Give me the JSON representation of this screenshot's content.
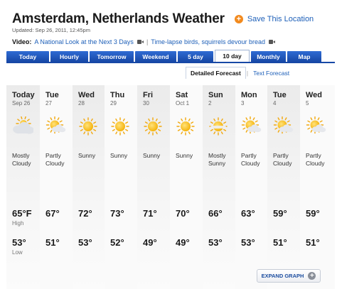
{
  "header": {
    "title": "Amsterdam, Netherlands Weather",
    "save_label": "This Location",
    "save_prefix": "Save",
    "save_icon": "plus-circle-icon",
    "updated": "Updated: Sep 26, 2011, 12:45pm"
  },
  "video": {
    "label": "Video:",
    "link1": "A National Look at the Next 3 Days",
    "separator": "|",
    "link2": "Time-lapse birds, squirrels devour bread"
  },
  "tabs": [
    {
      "label": "Today"
    },
    {
      "label": "Hourly"
    },
    {
      "label": "Tomorrow"
    },
    {
      "label": "Weekend"
    },
    {
      "label": "5 day"
    },
    {
      "label": "10 day",
      "active": true
    },
    {
      "label": "Monthly"
    },
    {
      "label": "Map"
    }
  ],
  "subtabs": {
    "detailed": "Detailed Forecast",
    "separator": "|",
    "text": "Text Forecast"
  },
  "forecast": [
    {
      "day": "Today",
      "date": "Sep 26",
      "icon": "mostly-cloudy-icon",
      "condition": "Mostly Cloudy",
      "high": "65°F",
      "high_label": "High",
      "low": "53°",
      "low_label": "Low"
    },
    {
      "day": "Tue",
      "date": "27",
      "icon": "partly-cloudy-icon",
      "condition": "Partly Cloudy",
      "high": "67°",
      "low": "51°"
    },
    {
      "day": "Wed",
      "date": "28",
      "icon": "sunny-icon",
      "condition": "Sunny",
      "high": "72°",
      "low": "53°"
    },
    {
      "day": "Thu",
      "date": "29",
      "icon": "sunny-icon",
      "condition": "Sunny",
      "high": "73°",
      "low": "52°"
    },
    {
      "day": "Fri",
      "date": "30",
      "icon": "sunny-icon",
      "condition": "Sunny",
      "high": "71°",
      "low": "49°"
    },
    {
      "day": "Sat",
      "date": "Oct 1",
      "icon": "sunny-icon",
      "condition": "Sunny",
      "high": "70°",
      "low": "49°"
    },
    {
      "day": "Sun",
      "date": "2",
      "icon": "mostly-sunny-icon",
      "condition": "Mostly Sunny",
      "high": "66°",
      "low": "53°"
    },
    {
      "day": "Mon",
      "date": "3",
      "icon": "partly-cloudy-icon",
      "condition": "Partly Cloudy",
      "high": "63°",
      "low": "53°"
    },
    {
      "day": "Tue",
      "date": "4",
      "icon": "partly-cloudy-icon",
      "condition": "Partly Cloudy",
      "high": "59°",
      "low": "51°"
    },
    {
      "day": "Wed",
      "date": "5",
      "icon": "partly-cloudy-icon",
      "condition": "Partly Cloudy",
      "high": "59°",
      "low": "51°"
    }
  ],
  "expand_graph": {
    "label": "EXPAND GRAPH",
    "icon": "plus-circle-icon"
  },
  "colors": {
    "link": "#1d5fb8",
    "tab": "#1748a6",
    "save_icon": "#f28a1e",
    "sun": "#f5b40e"
  }
}
